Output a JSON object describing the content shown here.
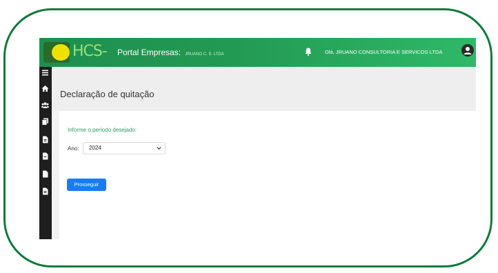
{
  "topbar": {
    "logo_text": "HCS-",
    "portal_title": "Portal Empresas:",
    "company_short": "JRUANO C. S. LTDA",
    "greeting": "Olá, JRUANO CONSULTORIA E SERVICOS LTDA"
  },
  "sidebar": {
    "icons": [
      "menu-icon",
      "home-icon",
      "users-icon",
      "documents-icon",
      "file-icon",
      "file-icon",
      "file-icon",
      "file-icon"
    ]
  },
  "page": {
    "title": "Declaração de quitação"
  },
  "form": {
    "period_label": "Informe o período desejado:",
    "year_label": "Ano:",
    "year_value": "2024",
    "submit_label": "Prosseguir"
  },
  "colors": {
    "frame": "#0e7a3a",
    "topbar_start": "#1d8f4d",
    "topbar_end": "#2fb968",
    "button": "#1a7cf3",
    "sidebar": "#1e1e1e"
  }
}
